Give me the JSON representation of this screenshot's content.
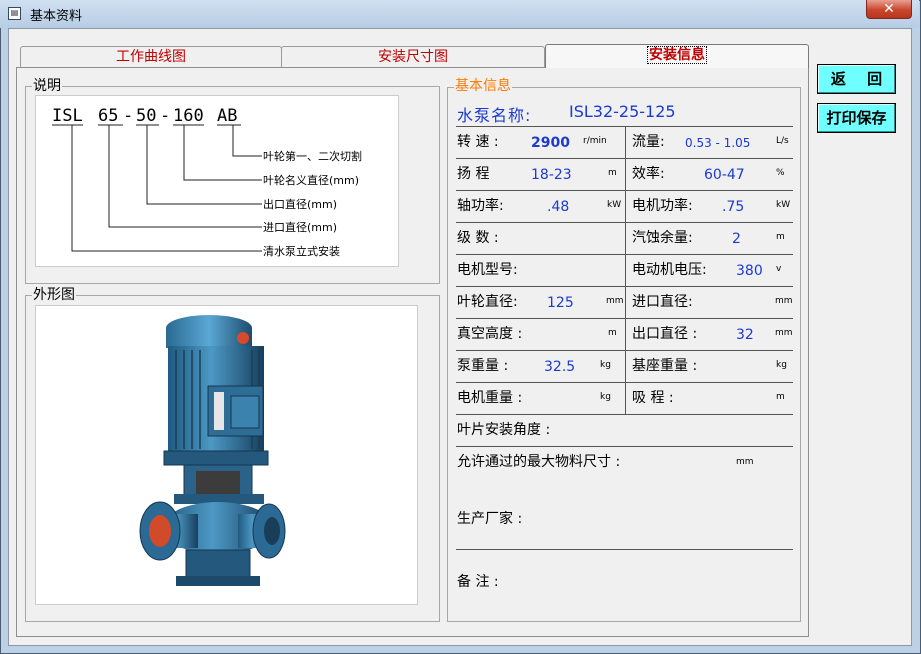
{
  "window": {
    "title": "基本资料",
    "close_glyph": "✕"
  },
  "tabs": [
    {
      "label": "工作曲线图",
      "active": false
    },
    {
      "label": "安装尺寸图",
      "active": false
    },
    {
      "label": "安装信息",
      "active": true
    }
  ],
  "buttons": {
    "return_label": "返 回",
    "print_label": "打印保存"
  },
  "description": {
    "group_label": "说明",
    "model_parts": [
      "ISL",
      "65",
      "50",
      "160",
      "AB"
    ],
    "separators": [
      "-",
      "-"
    ],
    "annotations": [
      "叶轮第一、二次切割",
      "叶轮名义直径(mm)",
      "出口直径(mm)",
      "进口直径(mm)",
      "清水泵立式安装"
    ]
  },
  "shape": {
    "group_label": "外形图"
  },
  "info": {
    "group_label": "基本信息",
    "pump_name_label": "水泵名称:",
    "pump_name_value": "ISL32-25-125",
    "rows": [
      {
        "left": {
          "label": "转 速 :",
          "value": "2900",
          "unit": "r/min"
        },
        "right": {
          "label": "流量:",
          "value": "0.53 - 1.05",
          "unit": "L/s"
        }
      },
      {
        "left": {
          "label": "扬 程",
          "value": "18-23",
          "unit": "m"
        },
        "right": {
          "label": "效率:",
          "value": "60-47",
          "unit": "%"
        }
      },
      {
        "left": {
          "label": "轴功率:",
          "value": ".48",
          "unit": "kW"
        },
        "right": {
          "label": "电机功率:",
          "value": ".75",
          "unit": "kW"
        }
      },
      {
        "left": {
          "label": "级 数 :",
          "value": "",
          "unit": ""
        },
        "right": {
          "label": "汽蚀余量:",
          "value": "2",
          "unit": "m"
        }
      },
      {
        "left": {
          "label": "电机型号:",
          "value": "",
          "unit": ""
        },
        "right": {
          "label": "电动机电压:",
          "value": "380",
          "unit": "v"
        }
      },
      {
        "left": {
          "label": "叶轮直径:",
          "value": "125",
          "unit": "mm"
        },
        "right": {
          "label": "进口直径:",
          "value": "",
          "unit": "mm"
        }
      },
      {
        "left": {
          "label": "真空高度 :",
          "value": "",
          "unit": "m"
        },
        "right": {
          "label": "出口直径 :",
          "value": "32",
          "unit": "mm"
        }
      },
      {
        "left": {
          "label": "泵重量 :",
          "value": "32.5",
          "unit": "kg"
        },
        "right": {
          "label": "基座重量 :",
          "value": "",
          "unit": "kg"
        }
      },
      {
        "left": {
          "label": "电机重量 :",
          "value": "",
          "unit": "kg"
        },
        "right": {
          "label": "吸 程 :",
          "value": "",
          "unit": "m"
        }
      }
    ],
    "blade_angle_label": "叶片安装角度 :",
    "max_particle_label": "允许通过的最大物料尺寸 :",
    "max_particle_unit": "mm",
    "manufacturer_label": "生产厂家 :",
    "remarks_label": "备 注 :"
  }
}
